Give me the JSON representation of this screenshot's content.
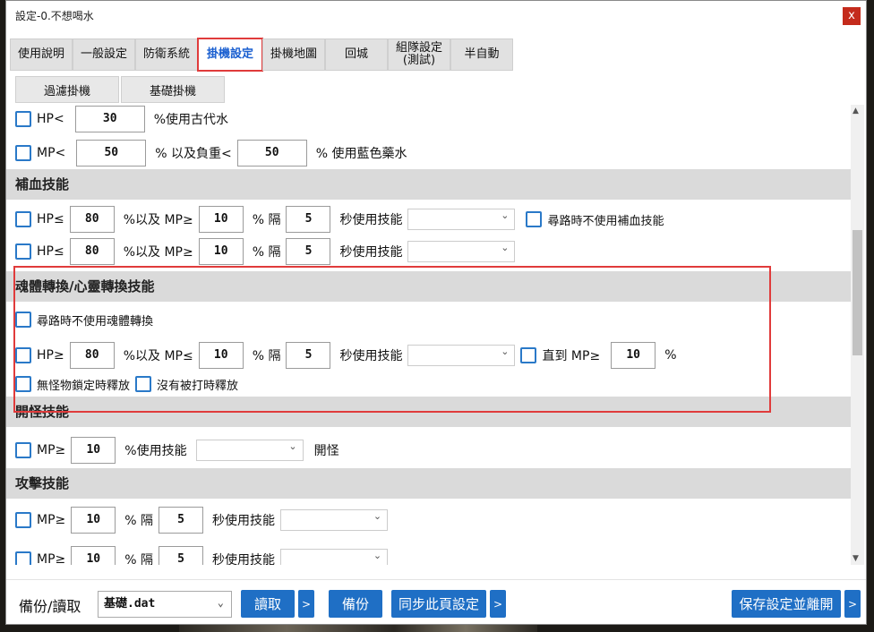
{
  "window": {
    "title": "設定-0.不想喝水",
    "close_label": "x"
  },
  "tabs": [
    {
      "label": "使用說明"
    },
    {
      "label": "一般設定"
    },
    {
      "label": "防衛系統"
    },
    {
      "label": "掛機設定"
    },
    {
      "label": "掛機地圖"
    },
    {
      "label": "回城"
    },
    {
      "label": "組隊設定\n(測試)"
    },
    {
      "label": "半自動"
    }
  ],
  "subtabs": [
    {
      "label": "過濾掛機"
    },
    {
      "label": "基礎掛機"
    }
  ],
  "potions": {
    "hp_label": "HP<",
    "hp_value": "30",
    "hp_suffix": "%使用古代水",
    "mp_label": "MP<",
    "mp_value": "50",
    "mp_mid": "% 以及負重<",
    "mp_weight": "50",
    "mp_suffix": "% 使用藍色藥水"
  },
  "heal": {
    "title": "補血技能",
    "row_hp": "HP≤",
    "row_mid": "%以及 MP≥",
    "row_interval": "% 隔",
    "row_suffix": "秒使用技能",
    "row1": {
      "hp": "80",
      "mp": "10",
      "sec": "5"
    },
    "row2": {
      "hp": "80",
      "mp": "10",
      "sec": "5"
    },
    "no_path_label": "尋路時不使用補血技能"
  },
  "soul": {
    "title": "魂體轉換/心靈轉換技能",
    "no_path_label": "尋路時不使用魂體轉換",
    "hp_label": "HP≥",
    "hp": "80",
    "mid": "%以及 MP≤",
    "mp": "10",
    "interval": "% 隔",
    "sec": "5",
    "suffix": "秒使用技能",
    "until_label": "直到 MP≥",
    "until_mp": "10",
    "until_suffix": "%",
    "release1": "無怪物鎖定時釋放",
    "release2": "沒有被打時釋放"
  },
  "open": {
    "title": "開怪技能",
    "mp_label": "MP≥",
    "mp": "10",
    "mid": "%使用技能",
    "suffix": "開怪"
  },
  "attack": {
    "title": "攻擊技能",
    "mp_label": "MP≥",
    "interval": "% 隔",
    "suffix": "秒使用技能",
    "row1": {
      "mp": "10",
      "sec": "5"
    },
    "row2": {
      "mp": "10",
      "sec": "5"
    }
  },
  "footer": {
    "label": "備份/讀取",
    "file": "基礎.dat",
    "read": "讀取",
    "arrow": ">",
    "backup": "備份",
    "sync": "同步此頁設定",
    "save": "保存設定並離開"
  },
  "colors": {
    "accent": "#1f6fc5",
    "highlight": "#e03b3b",
    "section": "#dadada"
  }
}
